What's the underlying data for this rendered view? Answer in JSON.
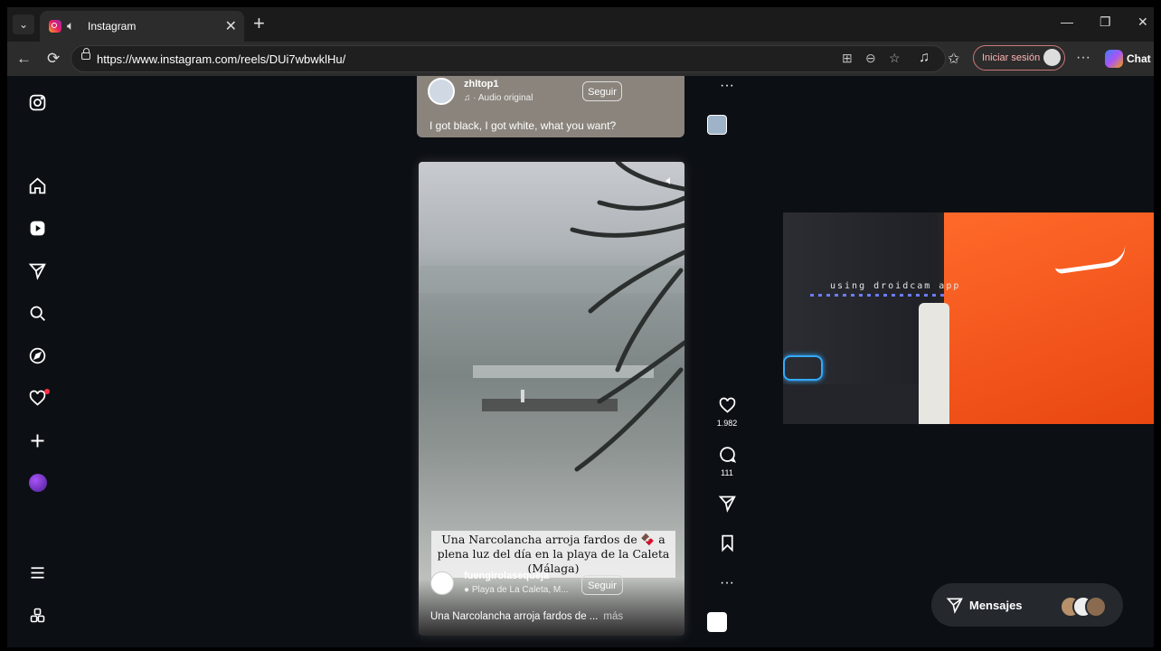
{
  "browser": {
    "tab": {
      "title": "Instagram"
    },
    "address": {
      "url": "https://www.instagram.com/reels/DUi7wbwklHu/"
    },
    "signin_label": "Iniciar sesión",
    "chat_label": "Chat"
  },
  "reel_prev": {
    "username": "zhltop1",
    "audio": "· Audio original",
    "follow_label": "Seguir",
    "caption": "I got black, I got white, what you want?"
  },
  "reel_current": {
    "overlay_text": "Una Narcolancha arroja fardos de 🍫 a plena luz del día en la playa de la Caleta (Málaga)",
    "username": "fuengirolasequeja",
    "location": "Playa de La Caleta, M...",
    "follow_label": "Seguir",
    "caption": "Una Narcolancha arroja fardos de ...",
    "more_label": "más",
    "likes": "1.982",
    "comments": "111"
  },
  "camera_overlay": {
    "watermark": "using droidcam app"
  },
  "messages": {
    "label": "Mensajes"
  },
  "colors": {
    "accent_notification": "#ff3040",
    "signin_border": "#c77"
  }
}
